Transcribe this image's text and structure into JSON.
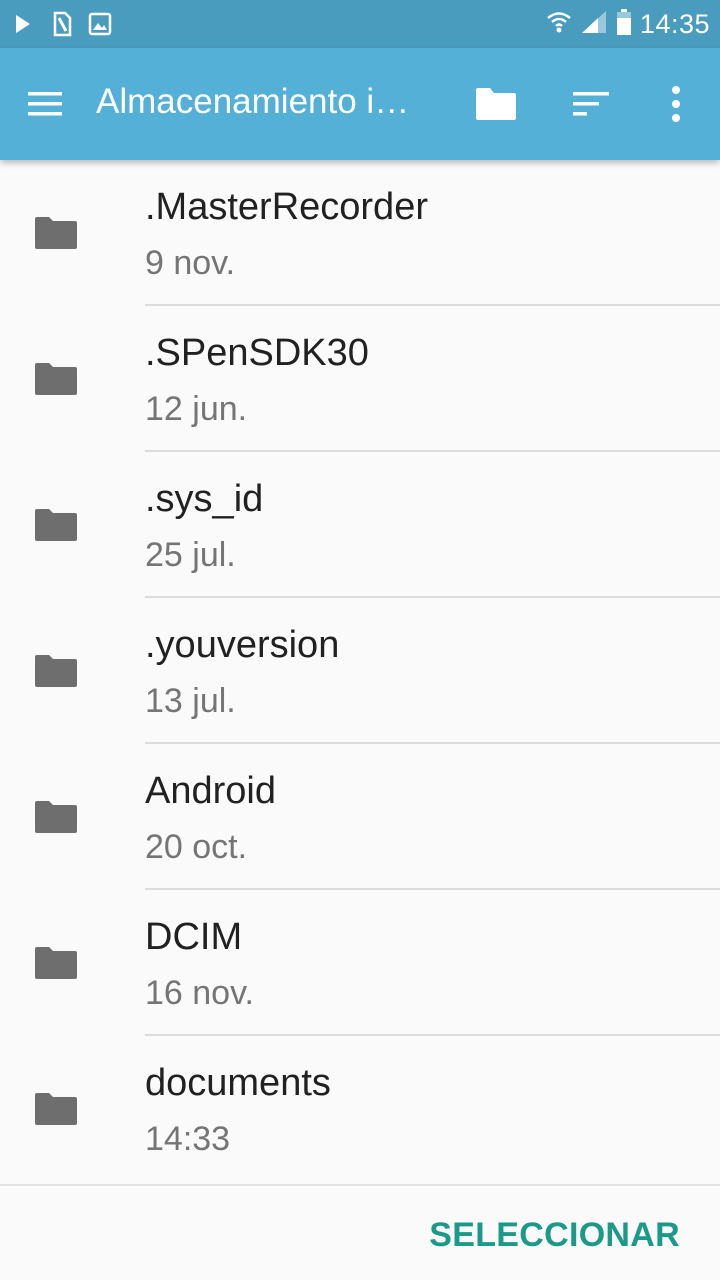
{
  "status_bar": {
    "time": "14:35",
    "icons_left": [
      "play-icon",
      "sim-card-icon",
      "image-icon"
    ],
    "icons_right": [
      "wifi-icon",
      "signal-icon",
      "battery-icon"
    ]
  },
  "app_bar": {
    "title": "Almacenamiento i…",
    "actions": [
      "new-folder-icon",
      "sort-icon",
      "more-options-icon"
    ]
  },
  "files": [
    {
      "name": ".MasterRecorder",
      "date": "9 nov."
    },
    {
      "name": ".SPenSDK30",
      "date": "12 jun."
    },
    {
      "name": ".sys_id",
      "date": "25 jul."
    },
    {
      "name": ".youversion",
      "date": "13 jul."
    },
    {
      "name": "Android",
      "date": "20 oct."
    },
    {
      "name": "DCIM",
      "date": "16 nov."
    },
    {
      "name": "documents",
      "date": "14:33"
    }
  ],
  "bottom_bar": {
    "select_label": "SELECCIONAR"
  },
  "colors": {
    "status_bar": "#4a9cbf",
    "app_bar": "#55b0d7",
    "accent": "#1b9a8a",
    "folder_icon": "#6e6e6e"
  }
}
